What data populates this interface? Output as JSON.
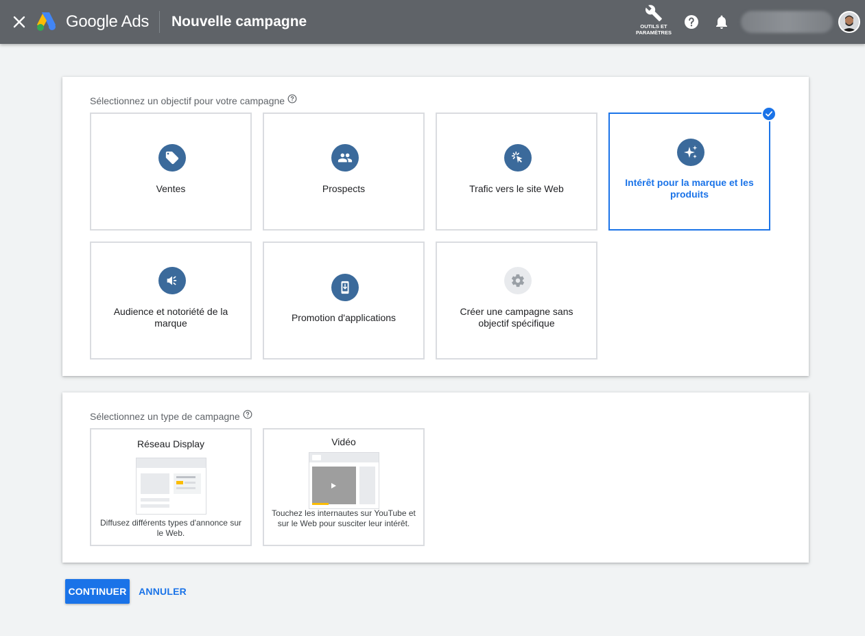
{
  "header": {
    "brand": "Google Ads",
    "title": "Nouvelle campagne",
    "tools_label": "OUTILS ET\nPARAMÈTRES",
    "icons": [
      "close-icon",
      "google-ads-logo",
      "wrench-icon",
      "help-icon",
      "bell-icon",
      "avatar"
    ]
  },
  "objectives": {
    "heading": "Sélectionnez un objectif pour votre campagne",
    "selected": "Intérêt pour la marque et les produits",
    "items": [
      {
        "label": "Ventes",
        "icon": "tag-icon"
      },
      {
        "label": "Prospects",
        "icon": "people-icon"
      },
      {
        "label": "Trafic vers le site Web",
        "icon": "cursor-click-icon"
      },
      {
        "label": "Intérêt pour la marque et les produits",
        "icon": "sparkle-icon"
      },
      {
        "label": "Audience et notoriété de la marque",
        "icon": "megaphone-icon"
      },
      {
        "label": "Promotion d'applications",
        "icon": "phone-download-icon"
      },
      {
        "label": "Créer une campagne sans objectif spécifique",
        "icon": "gear-icon"
      }
    ]
  },
  "campaign_types": {
    "heading": "Sélectionnez un type de campagne",
    "items": [
      {
        "name": "Réseau Display",
        "description": "Diffusez différents types d'annonce sur le Web."
      },
      {
        "name": "Vidéo",
        "description": "Touchez les internautes sur YouTube et sur le Web pour susciter leur intérêt."
      }
    ]
  },
  "actions": {
    "continue": "CONTINUER",
    "cancel": "ANNULER"
  },
  "colors": {
    "topbar": "#5f6368",
    "accent": "#1a73e8",
    "icon_bg": "#3b6a9b"
  }
}
